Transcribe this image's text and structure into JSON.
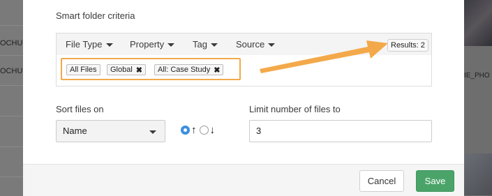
{
  "background": {
    "left_texts": [
      "OCHU",
      "OCHUR"
    ],
    "right_text": "IE_PHO"
  },
  "modal": {
    "criteria_title": "Smart folder criteria",
    "filters": [
      {
        "label": "File Type",
        "icon": "caret-down-icon"
      },
      {
        "label": "Property",
        "icon": "caret-down-icon"
      },
      {
        "label": "Tag",
        "icon": "caret-down-icon"
      },
      {
        "label": "Source",
        "icon": "caret-down-icon"
      }
    ],
    "results": "Results: 2",
    "chips": [
      {
        "label": "All Files",
        "removable": false
      },
      {
        "label": "Global",
        "removable": true
      },
      {
        "label": "All: Case Study",
        "removable": true
      }
    ],
    "chip_remove_glyph": "✖",
    "sort": {
      "label": "Sort files on",
      "selected": "Name",
      "asc_glyph": "↑",
      "desc_glyph": "↓",
      "direction": "ascending"
    },
    "limit": {
      "label": "Limit number of files to",
      "value": "3"
    },
    "footer": {
      "cancel": "Cancel",
      "save": "Save"
    }
  },
  "colors": {
    "highlight": "#f3a94a",
    "save": "#4aa46a",
    "radio_selected": "#3d8fe0"
  }
}
